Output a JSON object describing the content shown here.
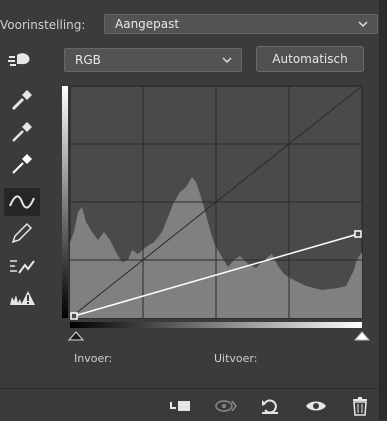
{
  "preset": {
    "label": "Voorinstelling:",
    "value": "Aangepast"
  },
  "channel": {
    "value": "RGB"
  },
  "auto_button": {
    "label": "Automatisch"
  },
  "tools": [
    {
      "icon": "target-adjust-icon"
    },
    {
      "icon": "black-point-eyedropper-icon"
    },
    {
      "icon": "gray-point-eyedropper-icon"
    },
    {
      "icon": "white-point-eyedropper-icon"
    },
    {
      "icon": "curve-points-icon"
    },
    {
      "icon": "pencil-icon"
    },
    {
      "icon": "smooth-curve-icon"
    },
    {
      "icon": "clipping-warning-icon"
    }
  ],
  "curve": {
    "input_label": "Invoer:",
    "output_label": "Uitvoer:",
    "points": [
      [
        0,
        0
      ],
      [
        255,
        115
      ]
    ]
  },
  "bottom_bar": {
    "icons": [
      "clip-to-layer-icon",
      "view-previous-icon",
      "reset-icon",
      "visibility-eye-icon",
      "trash-icon"
    ]
  },
  "colors": {
    "panel": "#3b3b3b",
    "graph_bg": "#4a4a4a",
    "histogram": "#808080",
    "curve": "#ffffff"
  }
}
